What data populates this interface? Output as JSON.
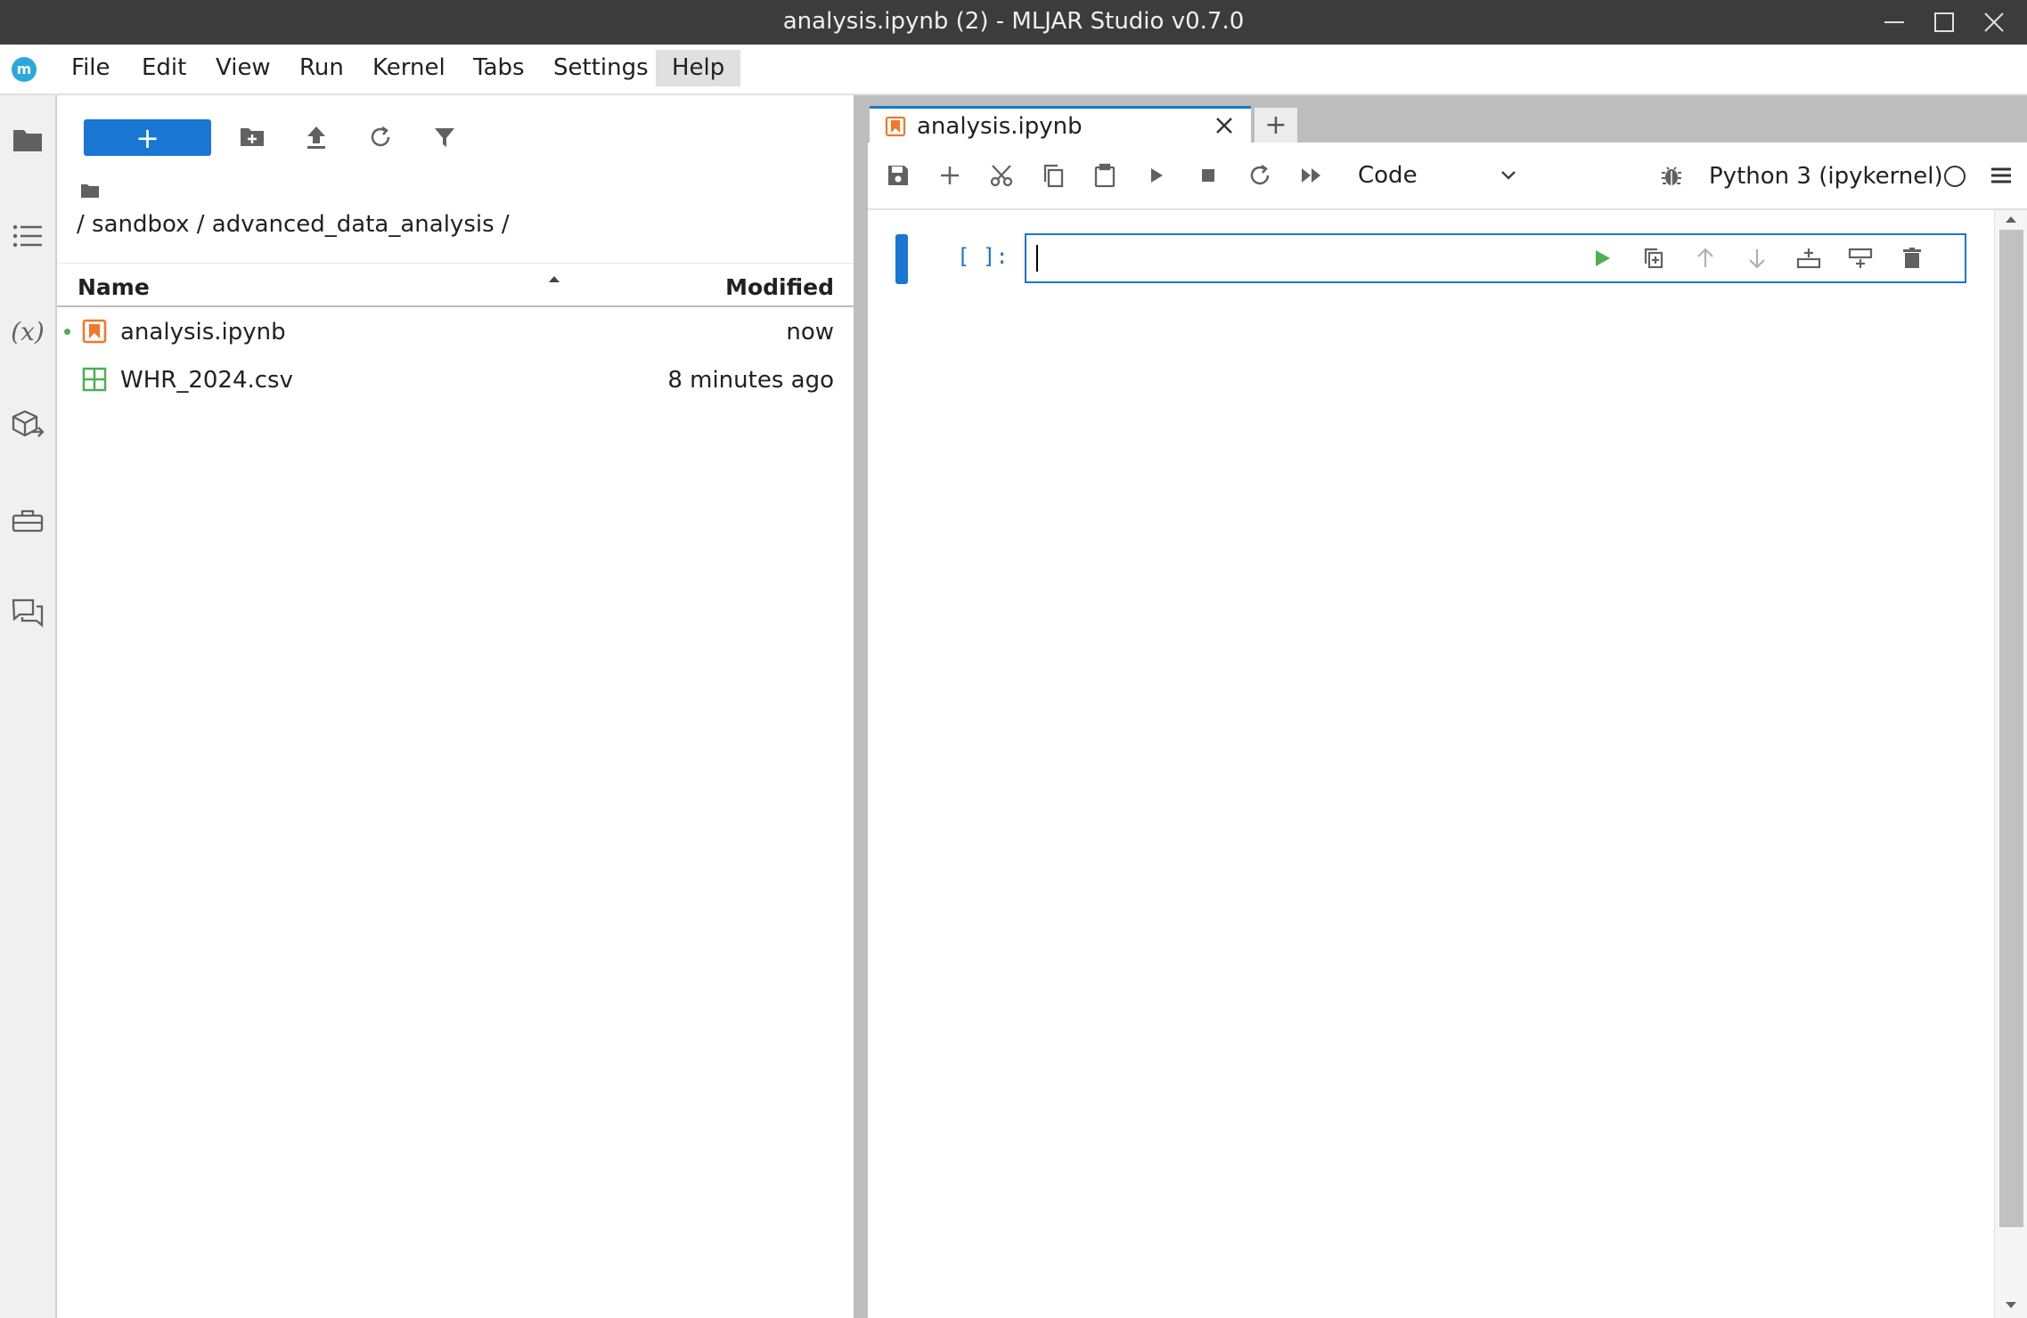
{
  "window": {
    "title": "analysis.ipynb (2) - MLJAR Studio v0.7.0",
    "controls": [
      "minimize-icon",
      "maximize-icon",
      "close-icon"
    ]
  },
  "menubar": {
    "logo": "m",
    "items": [
      "File",
      "Edit",
      "View",
      "Run",
      "Kernel",
      "Tabs",
      "Settings",
      "Help"
    ],
    "active": "Help"
  },
  "activitybar": {
    "icons": [
      "folder-icon",
      "table-of-contents-icon",
      "variables-icon",
      "extensions-icon",
      "toolbox-icon",
      "chat-icon"
    ],
    "variables_glyph": "(x)"
  },
  "filebrowser": {
    "new_button_label": "+",
    "toolbar_icons": [
      "new-folder-icon",
      "upload-icon",
      "refresh-icon",
      "filter-icon"
    ],
    "breadcrumb": "/ sandbox / advanced_data_analysis /",
    "columns": {
      "name": "Name",
      "modified": "Modified"
    },
    "files": [
      {
        "name": "analysis.ipynb",
        "modified": "now",
        "type": "notebook",
        "running": true
      },
      {
        "name": "WHR_2024.csv",
        "modified": "8 minutes ago",
        "type": "csv",
        "running": false
      }
    ]
  },
  "notebook": {
    "tab_label": "analysis.ipynb",
    "add_tab_label": "+",
    "toolbar_icons": [
      "save-icon",
      "add-cell-icon",
      "cut-icon",
      "copy-icon",
      "paste-icon",
      "run-icon",
      "stop-icon",
      "restart-icon",
      "run-all-icon"
    ],
    "cell_type": "Code",
    "kernel": "Python 3 (ipykernel)",
    "cell": {
      "prompt": "[ ]:",
      "content": "",
      "toolbar_icons": [
        "run-cell-icon",
        "duplicate-cell-icon",
        "move-up-icon",
        "move-down-icon",
        "insert-above-icon",
        "insert-below-icon",
        "delete-cell-icon"
      ]
    }
  },
  "colors": {
    "accent": "#1976d2",
    "titlebar": "#3c3c3c",
    "notebook_icon": "#f37726",
    "csv_icon": "#4caf50",
    "run_green": "#4caf50"
  }
}
